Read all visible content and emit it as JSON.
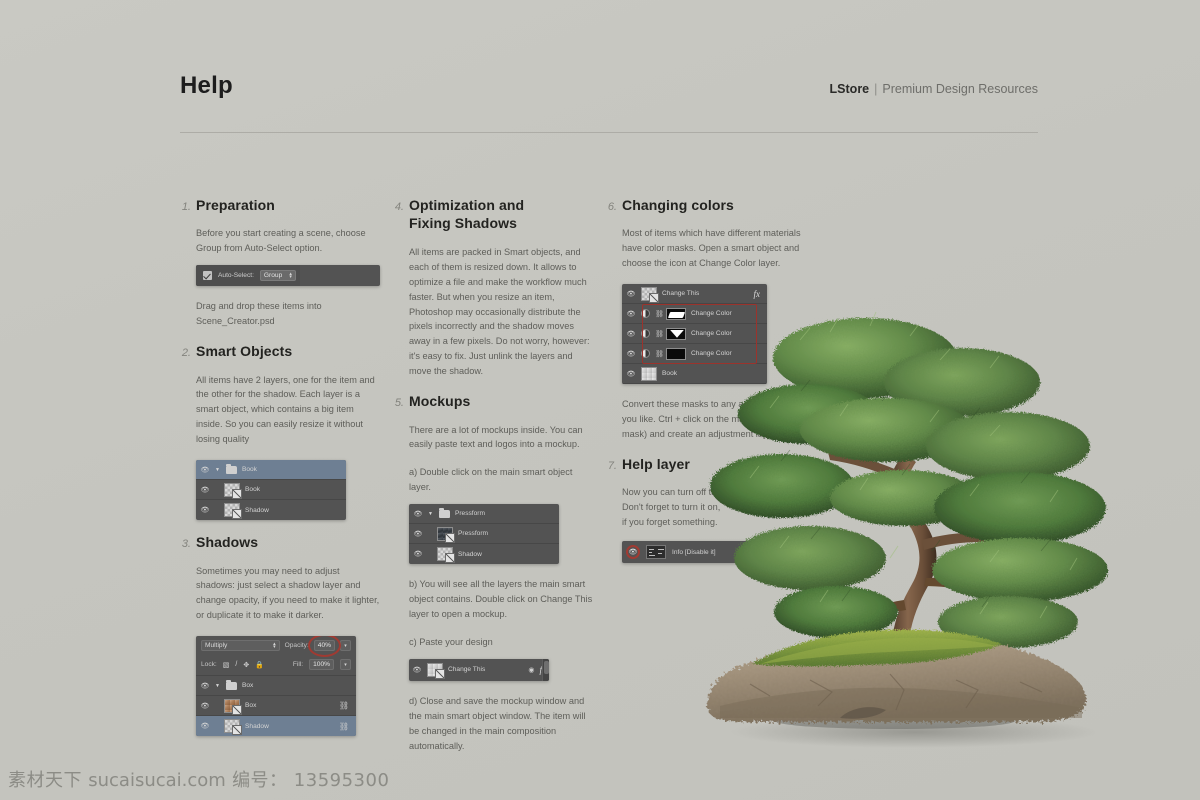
{
  "header": {
    "title": "Help",
    "brand_name": "LStore",
    "brand_separator": "|",
    "brand_tagline": "Premium Design Resources"
  },
  "sections": [
    {
      "num": "1.",
      "title": "Preparation",
      "paragraphs": [
        "Before you start creating a scene, choose Group from Auto-Select option.",
        "Drag and drop these items into Scene_Creator.psd"
      ],
      "widget": {
        "type": "autoselect-toolbar",
        "checkbox_label": "Auto-Select:",
        "dropdown_value": "Group"
      }
    },
    {
      "num": "2.",
      "title": "Smart Objects",
      "paragraphs": [
        "All items have 2 layers, one for the item and the other for the shadow. Each layer is a smart object, which contains a big item inside. So you can easily resize it without losing quality"
      ],
      "widget": {
        "type": "layers-panel",
        "rows": [
          {
            "name": "Book",
            "kind": "group",
            "selected": true
          },
          {
            "name": "Book",
            "kind": "smart-object"
          },
          {
            "name": "Shadow",
            "kind": "smart-object"
          }
        ]
      }
    },
    {
      "num": "3.",
      "title": "Shadows",
      "paragraphs": [
        "Sometimes you may need to adjust shadows: just select a shadow layer and change opacity, if you need to make it lighter, or duplicate it to make it darker."
      ],
      "widget": {
        "type": "layers-panel-full",
        "blend_mode": "Multiply",
        "opacity_label": "Opacity:",
        "opacity_value": "40%",
        "lock_label": "Lock:",
        "fill_label": "Fill:",
        "fill_value": "100%",
        "rows": [
          {
            "name": "Box",
            "kind": "group"
          },
          {
            "name": "Box",
            "kind": "smart-object",
            "linked": true
          },
          {
            "name": "Shadow",
            "kind": "smart-object",
            "linked": true,
            "selected": true
          }
        ]
      }
    },
    {
      "num": "4.",
      "title_line1": "Optimization and",
      "title_line2": "Fixing Shadows",
      "paragraphs": [
        "All items are packed in Smart objects, and each of them is resized down. It allows to optimize a file and make the workflow much faster. But when you resize an item, Photoshop may occasionally distribute the pixels incorrectly and the shadow moves away in a few pixels. Do not worry, however: it's easy to fix. Just unlink the layers and move the shadow."
      ]
    },
    {
      "num": "5.",
      "title": "Mockups",
      "paragraphs": [
        "There are a lot of mockups inside. You can easily paste text and logos into a mockup.",
        "a) Double click on the main smart object layer.",
        "b) You will see all the layers the main smart object contains. Double click on Change This layer to open a mockup.",
        "c) Paste your design",
        "d) Close and save the mockup window and the main smart object window. The item will be changed in the main composition automatically."
      ],
      "widget_a": {
        "type": "layers-panel",
        "rows": [
          {
            "name": "Pressform",
            "kind": "group"
          },
          {
            "name": "Pressform",
            "kind": "smart-object"
          },
          {
            "name": "Shadow",
            "kind": "smart-object"
          }
        ]
      },
      "widget_c": {
        "type": "single-layer",
        "name": "Change This",
        "fx_label": "fx"
      }
    },
    {
      "num": "6.",
      "title": "Changing colors",
      "paragraphs": [
        "Most of items which have different materials have color masks. Open a smart object and choose the icon at Change Color layer.",
        "Convert these masks to any adjustment layer you like. Ctrl + click on the mask (to select a mask) and create an adjustment layer."
      ],
      "widget": {
        "type": "color-layers-panel",
        "fx_label": "fx",
        "rows": [
          {
            "name": "Change This",
            "kind": "smart-object"
          },
          {
            "name": "Change Color",
            "kind": "adjustment",
            "mask": "shape"
          },
          {
            "name": "Change Color",
            "kind": "adjustment",
            "mask": "triangle"
          },
          {
            "name": "Change Color",
            "kind": "adjustment",
            "mask": "black"
          },
          {
            "name": "Book",
            "kind": "layer"
          }
        ]
      }
    },
    {
      "num": "7.",
      "title": "Help layer",
      "paragraphs": [
        "Now you can turn off the help layer.",
        " Don't forget to turn it on,",
        "if you forget something."
      ],
      "widget": {
        "type": "info-layer",
        "name": "Info [Disable it]"
      }
    }
  ],
  "image": {
    "subject": "bonsai-tree-on-rock"
  },
  "watermark": {
    "site_cn": "素材天下",
    "site": "sucaisucai.com",
    "id_label": "编号：",
    "id_value": "13595300"
  },
  "colors": {
    "background": "#c6c6c0",
    "title": "#1d1d1d",
    "body_text": "#5e5e59",
    "panel": "#535353",
    "panel_selected": "#6e7f93",
    "accent_red": "#a03a32"
  }
}
